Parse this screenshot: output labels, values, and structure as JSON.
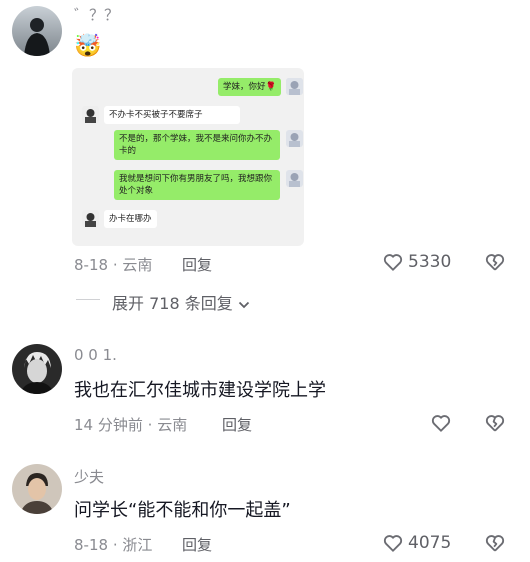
{
  "comments": [
    {
      "username": "゛？？",
      "emoji": "🤯",
      "screenshot_messages": [
        {
          "side": "right",
          "text": "学妹，你好🌹"
        },
        {
          "side": "left",
          "text": "不办卡不买被子不要席子"
        },
        {
          "side": "right",
          "text": "不是的，那个学妹，我不是来问你办不办卡的"
        },
        {
          "side": "right",
          "text": "我就是想问下你有男朋友了吗，我想跟你处个对象"
        },
        {
          "side": "left",
          "text": "办卡在哪办"
        }
      ],
      "date": "8-18",
      "location": "云南",
      "reply_label": "回复",
      "likes": "5330"
    },
    {
      "username": "0 0 1.",
      "text": "我也在汇尔佳城市建设学院上学",
      "date": "14 分钟前",
      "location": "云南",
      "reply_label": "回复"
    },
    {
      "username": "少夫",
      "text": "问学长“能不能和你一起盖”",
      "date": "8-18",
      "location": "浙江",
      "reply_label": "回复",
      "likes": "4075"
    }
  ],
  "expand_replies": "展开 718 条回复",
  "separator": "·",
  "icons": {
    "like": "heart-outline-icon",
    "dislike": "broken-heart-icon",
    "expand": "chevron-down-icon"
  }
}
